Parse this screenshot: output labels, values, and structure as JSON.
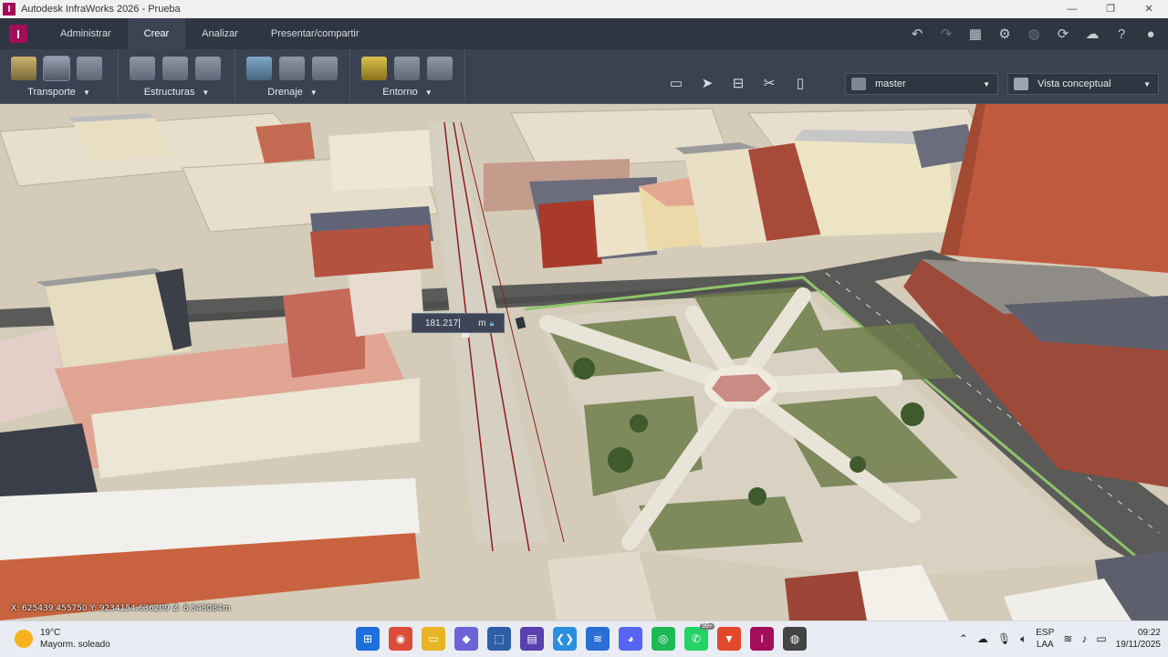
{
  "window": {
    "title": "Autodesk InfraWorks 2026 - Prueba",
    "app_icon_letter": "I",
    "controls": [
      "—",
      "❐",
      "✕"
    ]
  },
  "menubar": {
    "logo_letter": "I",
    "tabs": [
      {
        "label": "Administrar",
        "active": false
      },
      {
        "label": "Crear",
        "active": true
      },
      {
        "label": "Analizar",
        "active": false
      },
      {
        "label": "Presentar/compartir",
        "active": false
      }
    ],
    "right_icons": [
      "undo-icon",
      "redo-icon",
      "grid-icon",
      "settings-icon",
      "globe-icon",
      "sync-icon",
      "cloud-icon",
      "help-icon",
      "user-icon"
    ]
  },
  "ribbon": {
    "groups": [
      {
        "label": "Transporte",
        "icons": [
          "road-icon",
          "lanes-icon",
          "rail-icon"
        ]
      },
      {
        "label": "Estructuras",
        "icons": [
          "bridge-icon",
          "tunnel-icon",
          "building-icon"
        ]
      },
      {
        "label": "Drenaje",
        "icons": [
          "pond-icon",
          "pipe-icon",
          "culvert-icon"
        ]
      },
      {
        "label": "Entorno",
        "icons": [
          "traffic-light-icon",
          "city-furniture-icon",
          "tree-settings-icon"
        ]
      }
    ],
    "tools": [
      "screen-icon",
      "select-icon",
      "measure-icon",
      "trim-icon",
      "ruler-icon"
    ],
    "branch_dropdown": "master",
    "style_dropdown": "Vista conceptual"
  },
  "viewport": {
    "measurement_value": "181.217",
    "measurement_unit": "m",
    "coordinates": "X: 625439.455750 Y: 9234154.636209 Z: 8.543084m"
  },
  "taskbar": {
    "temperature": "19°C",
    "weather": "Mayorm. soleado",
    "apps": [
      {
        "name": "windows-start-icon",
        "glyph": "⊞",
        "color": "#1e6fd9"
      },
      {
        "name": "chrome-icon",
        "glyph": "◉",
        "color": "#dd4b39"
      },
      {
        "name": "file-explorer-icon",
        "glyph": "▭",
        "color": "#e8b423"
      },
      {
        "name": "app-cube-icon",
        "glyph": "◆",
        "color": "#6b63d6"
      },
      {
        "name": "app-blue-icon",
        "glyph": "⬚",
        "color": "#2c5fa8"
      },
      {
        "name": "app-purple-icon",
        "glyph": "▤",
        "color": "#5a3fb0"
      },
      {
        "name": "vscode-icon",
        "glyph": "❮❯",
        "color": "#2a8fe0"
      },
      {
        "name": "app-stack-icon",
        "glyph": "≋",
        "color": "#2a6fd6"
      },
      {
        "name": "discord-icon",
        "glyph": "◕",
        "color": "#5865f2"
      },
      {
        "name": "spotify-icon",
        "glyph": "◎",
        "color": "#1db954"
      },
      {
        "name": "whatsapp-icon",
        "glyph": "✆",
        "color": "#25d366",
        "badge": "99+"
      },
      {
        "name": "brave-icon",
        "glyph": "▼",
        "color": "#e2492a"
      },
      {
        "name": "infraworks-icon",
        "glyph": "I",
        "color": "#a30d5a"
      },
      {
        "name": "obs-icon",
        "glyph": "◍",
        "color": "#444444"
      }
    ],
    "language_top": "ESP",
    "language_bottom": "LAA",
    "time": "09:22",
    "date": "19/11/2025"
  }
}
